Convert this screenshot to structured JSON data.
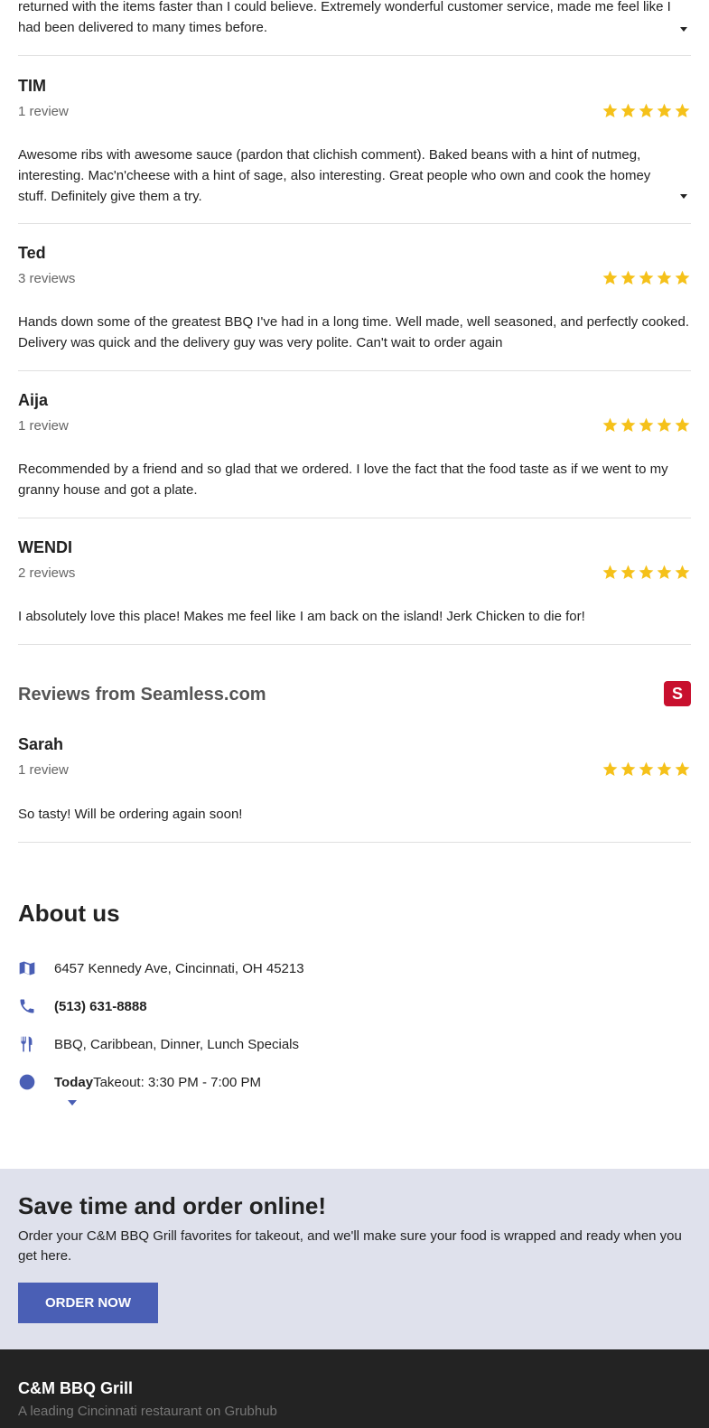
{
  "reviews": [
    {
      "text": "returned with the items faster than I could believe. Extremely wonderful customer service, made me feel like I had been delivered to many times before."
    },
    {
      "name": "TIM",
      "count": "1 review",
      "rating": 5,
      "text": "Awesome ribs with awesome sauce (pardon that clichish comment). Baked beans with a hint of nutmeg, interesting. Mac'n'cheese with a hint of sage, also interesting. Great people who own and cook the homey stuff. Definitely give them a try."
    },
    {
      "name": "Ted",
      "count": "3 reviews",
      "rating": 5,
      "text": "Hands down some of the greatest BBQ I've had in a long time. Well made, well seasoned, and perfectly cooked. Delivery was quick and the delivery guy was very polite. Can't wait to order again"
    },
    {
      "name": "Aija",
      "count": "1 review",
      "rating": 5,
      "text": "Recommended by a friend and so glad that we ordered. I love the fact that the food taste as if we went to my granny house and got a plate."
    },
    {
      "name": "WENDI",
      "count": "2 reviews",
      "rating": 5,
      "text": "I absolutely love this place! Makes me feel like I am back on the island! Jerk Chicken to die for!"
    }
  ],
  "seamless": {
    "title": "Reviews from Seamless.com",
    "logo_letter": "S",
    "review": {
      "name": "Sarah",
      "count": "1 review",
      "rating": 5,
      "text": "So tasty! Will be ordering again soon!"
    }
  },
  "about": {
    "title": "About us",
    "address": "6457 Kennedy Ave, Cincinnati, OH 45213",
    "phone": "(513) 631-8888",
    "cuisines": "BBQ, Caribbean, Dinner, Lunch Specials",
    "hours_day": "Today",
    "hours_text": "Takeout: 3:30 PM - 7:00 PM"
  },
  "promo": {
    "title": "Save time and order online!",
    "text": "Order your C&M BBQ Grill favorites for takeout, and we'll make sure your food is wrapped and ready when you get here.",
    "button": "ORDER NOW"
  },
  "footer": {
    "name": "C&M BBQ Grill",
    "tagline": "A leading Cincinnati restaurant on Grubhub"
  },
  "colors": {
    "accent": "#4a5fb5",
    "star": "#f5c11a",
    "seamless": "#c8102e",
    "promo_bg": "#dfe1ec",
    "footer_bg": "#232323"
  }
}
